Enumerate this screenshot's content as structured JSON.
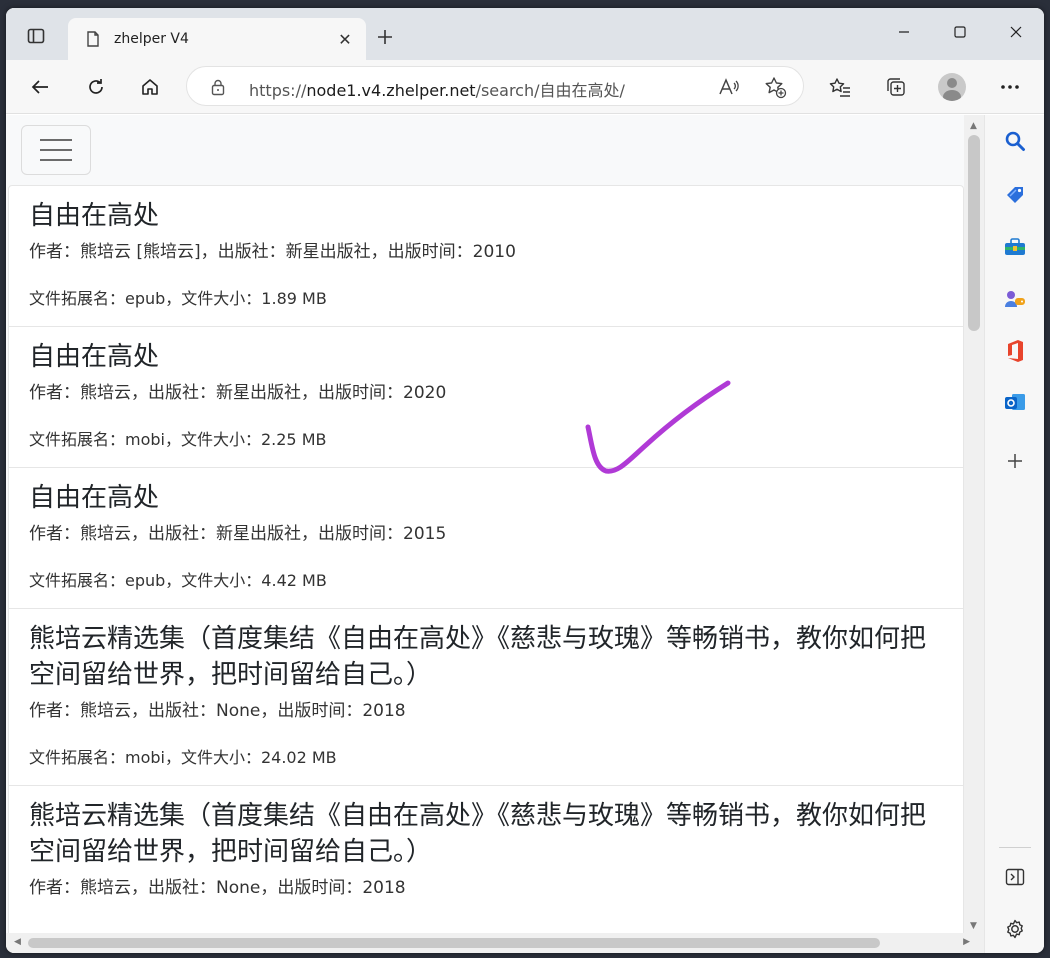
{
  "browser": {
    "tab_title": "zhelper V4",
    "url_prefix": "https://",
    "url_host": "node1.v4.zhelper.net",
    "url_path": "/search/自由在高处/"
  },
  "results": [
    {
      "title": "自由在高处",
      "meta": "作者：熊培云 [熊培云]，出版社：新星出版社，出版时间：2010",
      "file": "文件拓展名：epub，文件大小：1.89 MB"
    },
    {
      "title": "自由在高处",
      "meta": "作者：熊培云，出版社：新星出版社，出版时间：2020",
      "file": "文件拓展名：mobi，文件大小：2.25 MB"
    },
    {
      "title": "自由在高处",
      "meta": "作者：熊培云，出版社：新星出版社，出版时间：2015",
      "file": "文件拓展名：epub，文件大小：4.42 MB"
    },
    {
      "title": "熊培云精选集（首度集结《自由在高处》《慈悲与玫瑰》等畅销书，教你如何把空间留给世界，把时间留给自己。）",
      "meta": "作者：熊培云，出版社：None，出版时间：2018",
      "file": "文件拓展名：mobi，文件大小：24.02 MB"
    },
    {
      "title": "熊培云精选集（首度集结《自由在高处》《慈悲与玫瑰》等畅销书，教你如何把空间留给世界，把时间留给自己。）",
      "meta": "作者：熊培云，出版社：None，出版时间：2018",
      "file": ""
    }
  ],
  "colors": {
    "annotation_check": "#b03ad6",
    "accent": "#0067c0"
  },
  "icons": {
    "sidebar": [
      "search-icon",
      "tag-icon",
      "toolbox-icon",
      "games-icon",
      "office-icon",
      "outlook-icon",
      "plus-icon"
    ],
    "sidebar_bottom": [
      "split-screen-icon",
      "gear-icon"
    ]
  }
}
